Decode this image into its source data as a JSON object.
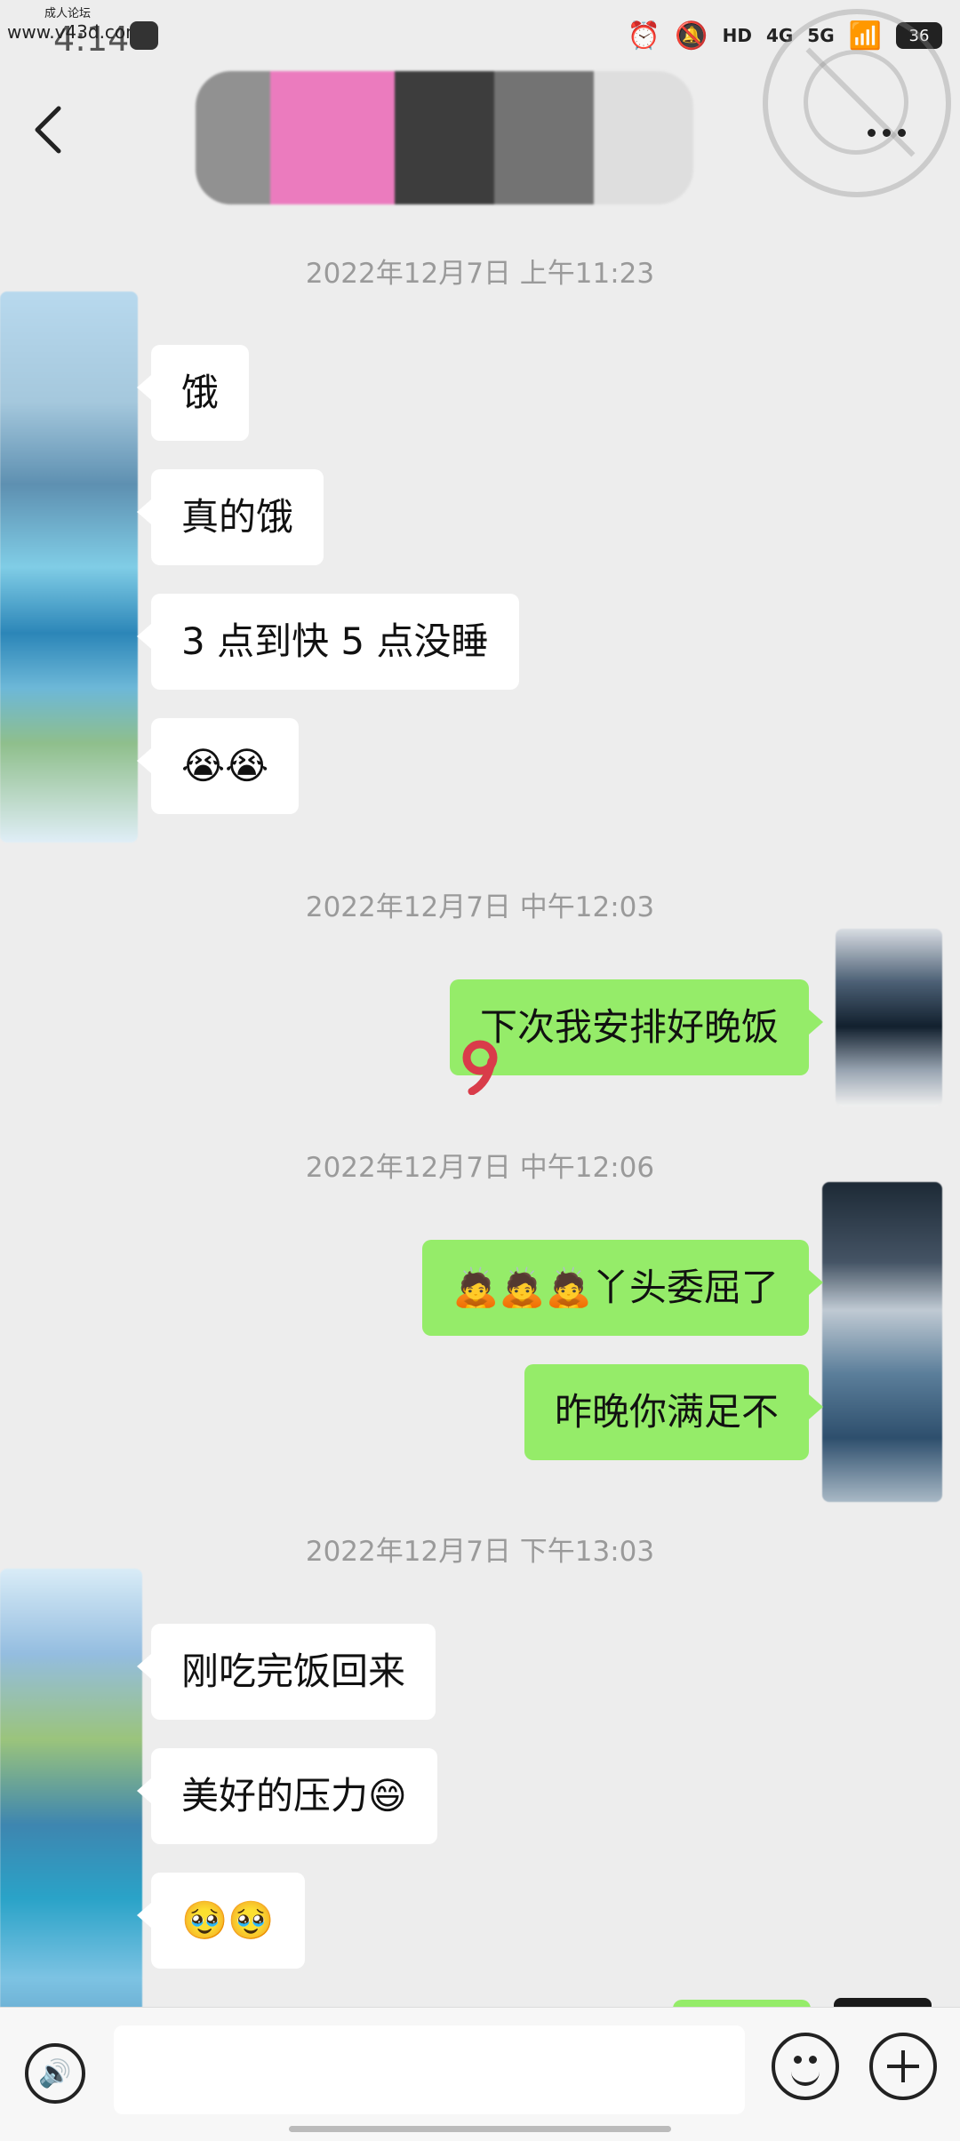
{
  "status_bar": {
    "watermark_small": "成人论坛",
    "watermark_url": "www.v43d.com",
    "time": "4:14",
    "icons": [
      "alarm-icon",
      "mute-icon",
      "hd-icon",
      "4g-signal-icon",
      "5g-signal-icon",
      "wifi-icon",
      "battery-icon"
    ],
    "hd_label": "HD",
    "network_4g": "4G",
    "network_5g": "5G",
    "battery_level": "36"
  },
  "header": {
    "title": ""
  },
  "messages": [
    {
      "type": "timestamp",
      "text": "2022年12月7日 上午11:23"
    },
    {
      "type": "received",
      "text": "饿"
    },
    {
      "type": "received",
      "text": "真的饿"
    },
    {
      "type": "received",
      "text": "3 点到快 5 点没睡"
    },
    {
      "type": "received",
      "text": "😭😭"
    },
    {
      "type": "timestamp",
      "text": "2022年12月7日 中午12:03"
    },
    {
      "type": "sent",
      "text": "下次我安排好晚饭"
    },
    {
      "type": "timestamp",
      "text": "2022年12月7日 中午12:06"
    },
    {
      "type": "sent",
      "text": "🙇🙇🙇丫头委屈了"
    },
    {
      "type": "sent",
      "text": "昨晚你满足不"
    },
    {
      "type": "timestamp",
      "text": "2022年12月7日 下午13:03"
    },
    {
      "type": "received",
      "text": "刚吃完饭回来"
    },
    {
      "type": "received",
      "text": "美好的压力😄"
    },
    {
      "type": "received",
      "text": "🥹🥹"
    }
  ],
  "input_bar": {
    "placeholder": ""
  },
  "colors": {
    "background": "#ededed",
    "sent_bubble": "#95ec69",
    "received_bubble": "#ffffff",
    "timestamp_text": "#9a9a9a"
  }
}
